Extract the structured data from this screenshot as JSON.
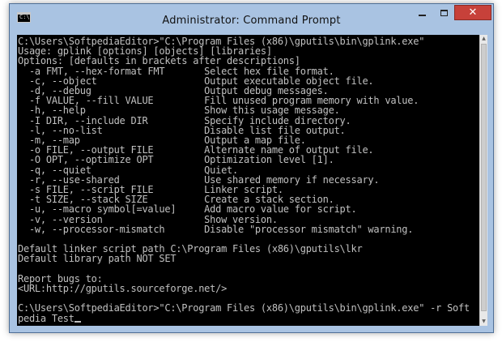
{
  "window": {
    "title": "Administrator: Command Prompt",
    "icon_label": "C:\\"
  },
  "controls": {
    "close_glyph": "✕"
  },
  "console": {
    "lines": [
      "C:\\Users\\SoftpediaEditor>\"C:\\Program Files (x86)\\gputils\\bin\\gplink.exe\"",
      "Usage: gplink [options] [objects] [libraries]",
      "Options: [defaults in brackets after descriptions]",
      "  -a FMT, --hex-format FMT       Select hex file format.",
      "  -c, --object                   Output executable object file.",
      "  -d, --debug                    Output debug messages.",
      "  -f VALUE, --fill VALUE         Fill unused program memory with value.",
      "  -h, --help                     Show this usage message.",
      "  -I DIR, --include DIR          Specify include directory.",
      "  -l, --no-list                  Disable list file output.",
      "  -m, --map                      Output a map file.",
      "  -o FILE, --output FILE         Alternate name of output file.",
      "  -O OPT, --optimize OPT         Optimization level [1].",
      "  -q, --quiet                    Quiet.",
      "  -r, --use-shared               Use shared memory if necessary.",
      "  -s FILE, --script FILE         Linker script.",
      "  -t SIZE, --stack SIZE          Create a stack section.",
      "  -u, --macro symbol[=value]     Add macro value for script.",
      "  -v, --version                  Show version.",
      "  -w, --processor-mismatch       Disable \"processor mismatch\" warning.",
      "",
      "Default linker script path C:\\Program Files (x86)\\gputils\\lkr",
      "Default library path NOT SET",
      "",
      "Report bugs to:",
      "<URL:http://gputils.sourceforge.net/>",
      "",
      "C:\\Users\\SoftpediaEditor>\"C:\\Program Files (x86)\\gputils\\bin\\gplink.exe\" -r Soft",
      "pedia Test"
    ]
  },
  "colors": {
    "console_bg": "#000000",
    "console_text": "#c0c0c0",
    "frame": "#a9c3e2",
    "close_button": "#c7413a"
  }
}
